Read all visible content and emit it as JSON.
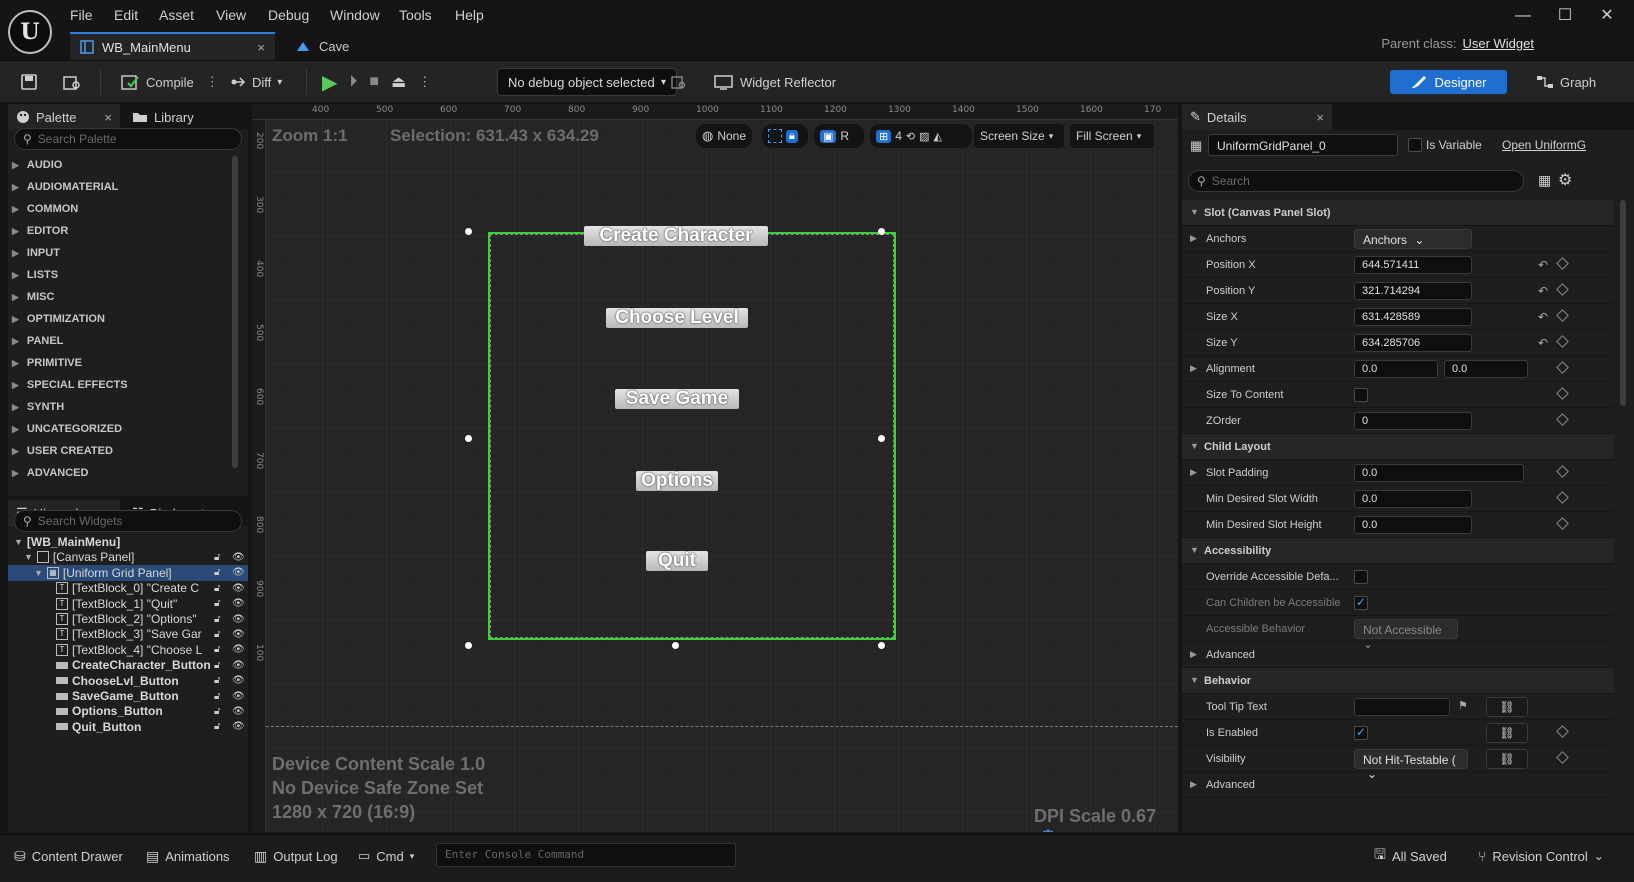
{
  "menu": [
    "File",
    "Edit",
    "Asset",
    "View",
    "Debug",
    "Window",
    "Tools",
    "Help"
  ],
  "logo_text": "U",
  "tabs": [
    {
      "label": "WB_MainMenu",
      "close": "×"
    },
    {
      "label": "Cave"
    }
  ],
  "window_controls": {
    "minimize": "—",
    "maximize": "☐",
    "close": "✕"
  },
  "parent_class": {
    "label": "Parent class:",
    "value": "User Widget"
  },
  "toolbar": {
    "compile": "Compile",
    "diff": "Diff",
    "debug_select": "No debug object selected",
    "widget_reflector": "Widget Reflector",
    "designer": "Designer",
    "graph": "Graph"
  },
  "palette": {
    "tab": "Palette",
    "library_tab": "Library",
    "search_placeholder": "Search Palette",
    "categories": [
      "AUDIO",
      "AUDIOMATERIAL",
      "COMMON",
      "EDITOR",
      "INPUT",
      "LISTS",
      "MISC",
      "OPTIMIZATION",
      "PANEL",
      "PRIMITIVE",
      "SPECIAL EFFECTS",
      "SYNTH",
      "UNCATEGORIZED",
      "USER CREATED",
      "ADVANCED"
    ]
  },
  "hierarchy": {
    "tab": "Hierarchy",
    "bindings_tab": "Bind...gets",
    "search_placeholder": "Search Widgets",
    "items": [
      {
        "label": "[WB_MainMenu]"
      },
      {
        "label": "[Canvas Panel]"
      },
      {
        "label": "[Uniform Grid Panel]"
      },
      {
        "label": "[TextBlock_0] \"Create C"
      },
      {
        "label": "[TextBlock_1] \"Quit\""
      },
      {
        "label": "[TextBlock_2] \"Options\""
      },
      {
        "label": "[TextBlock_3] \"Save Gar"
      },
      {
        "label": "[TextBlock_4] \"Choose L"
      },
      {
        "label": "CreateCharacter_Button"
      },
      {
        "label": "ChooseLvl_Button"
      },
      {
        "label": "SaveGame_Button"
      },
      {
        "label": "Options_Button"
      },
      {
        "label": "Quit_Button"
      }
    ]
  },
  "viewport": {
    "zoom": "Zoom 1:1",
    "selection": "Selection: 631.43 x 634.29",
    "ruler_top": [
      "400",
      "500",
      "600",
      "700",
      "800",
      "900",
      "1000",
      "1100",
      "1200",
      "1300",
      "1400",
      "1500",
      "1600",
      "170"
    ],
    "ruler_left": [
      "200",
      "300",
      "400",
      "500",
      "600",
      "700",
      "800",
      "900",
      "100"
    ],
    "tools": {
      "none": "None",
      "r": "R",
      "grid_num": "4",
      "screen_size": "Screen Size",
      "fill_screen": "Fill Screen"
    },
    "device_lines": [
      "Device Content Scale 1.0",
      "No Device Safe Zone Set",
      "1280 x 720 (16:9)"
    ],
    "dpi_scale": "DPI Scale 0.67",
    "buttons": [
      "Create Character",
      "Choose Level",
      "Save Game",
      "Options",
      "Quit"
    ]
  },
  "details": {
    "tab": "Details",
    "widget_name": "UniformGridPanel_0",
    "is_variable": "Is Variable",
    "open_link": "Open UniformG",
    "search_placeholder": "Search",
    "rows": {
      "slot_header": "Slot (Canvas Panel Slot)",
      "anchors": "Anchors",
      "anchors_value": "Anchors",
      "pos_x": "Position X",
      "pos_x_value": "644.571411",
      "pos_y": "Position Y",
      "pos_y_value": "321.714294",
      "size_x": "Size X",
      "size_x_value": "631.428589",
      "size_y": "Size Y",
      "size_y_value": "634.285706",
      "alignment": "Alignment",
      "align_x": "0.0",
      "align_y": "0.0",
      "size_to_content": "Size To Content",
      "zorder": "ZOrder",
      "zorder_value": "0",
      "child_layout": "Child Layout",
      "slot_padding": "Slot Padding",
      "slot_padding_value": "0.0",
      "min_w": "Min Desired Slot Width",
      "min_w_value": "0.0",
      "min_h": "Min Desired Slot Height",
      "min_h_value": "0.0",
      "accessibility": "Accessibility",
      "override_acc": "Override Accessible Defa...",
      "children_acc": "Can Children be Accessible",
      "acc_behavior": "Accessible Behavior",
      "acc_behavior_value": "Not Accessible",
      "advanced": "Advanced",
      "behavior": "Behavior",
      "tooltip": "Tool Tip Text",
      "is_enabled": "Is Enabled",
      "visibility": "Visibility",
      "visibility_value": "Not Hit-Testable (",
      "advanced2": "Advanced"
    }
  },
  "statusbar": {
    "content_drawer": "Content Drawer",
    "animations": "Animations",
    "output_log": "Output Log",
    "cmd": "Cmd",
    "console_placeholder": "Enter Console Command",
    "all_saved": "All Saved",
    "revision_control": "Revision Control"
  },
  "colors": {
    "accent": "#1e6fd0",
    "selection": "#36d436",
    "tab_accent": "#2c7fe0"
  }
}
